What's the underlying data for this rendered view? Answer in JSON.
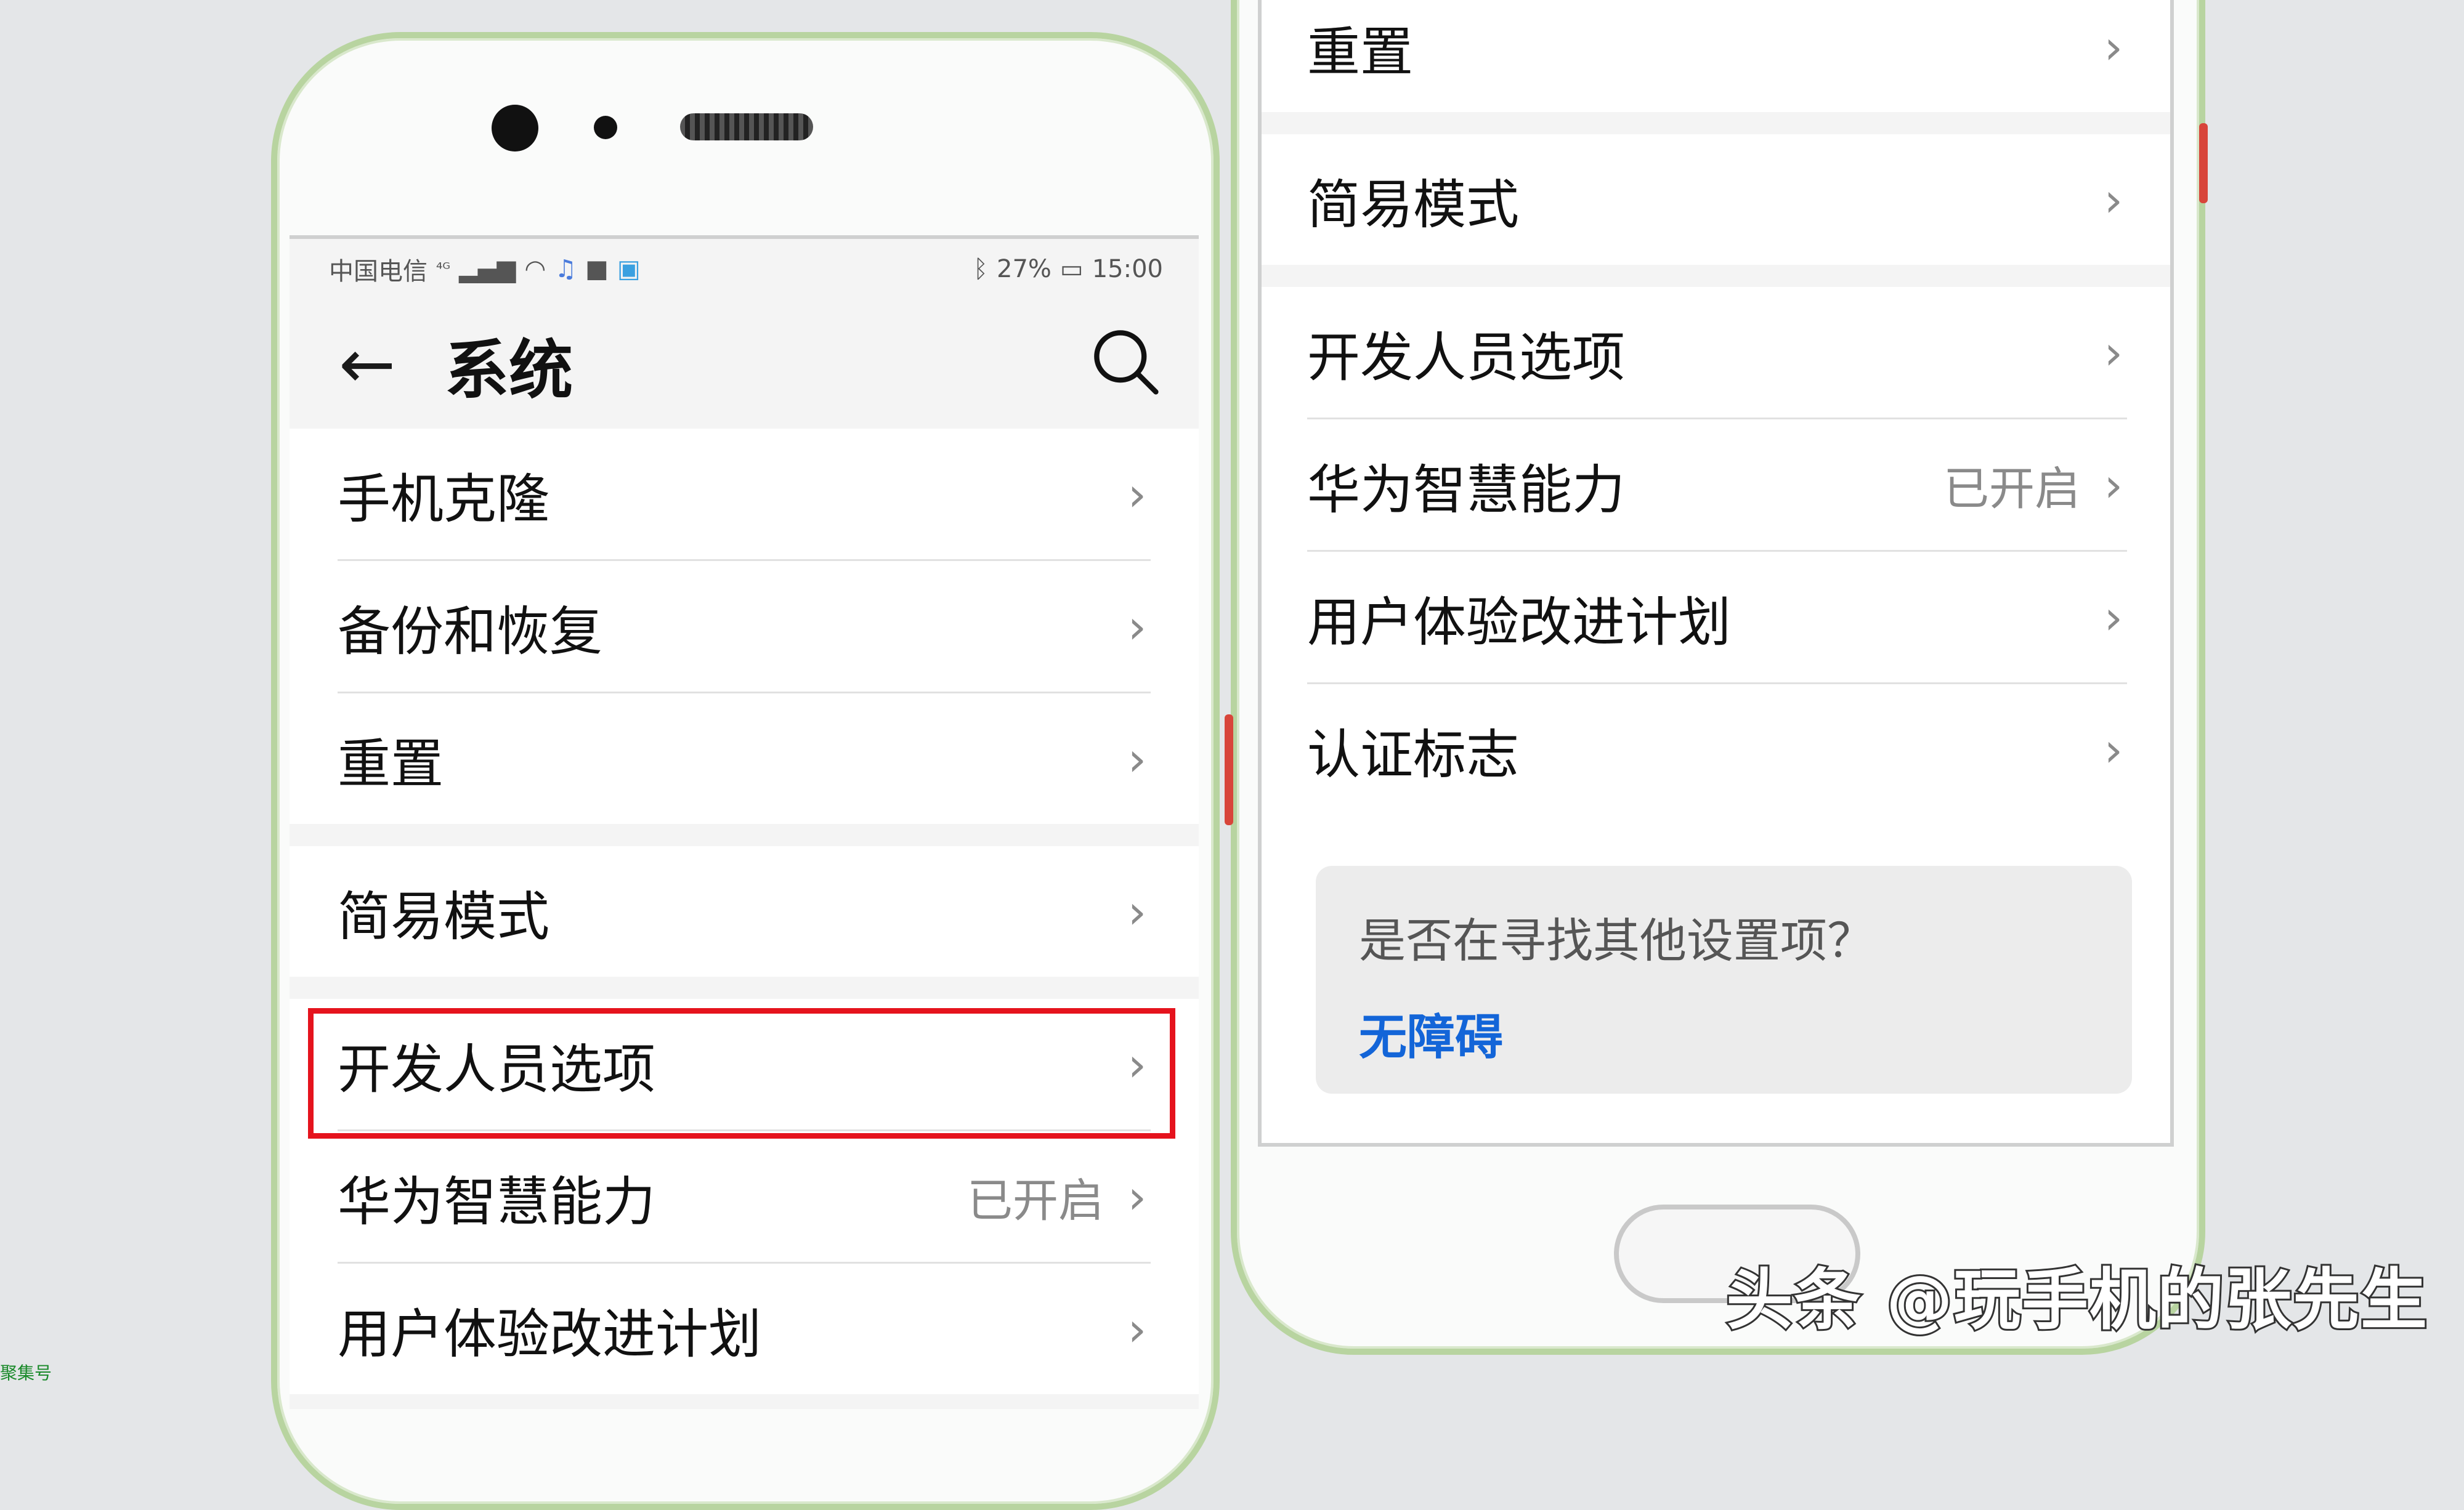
{
  "status_bar": {
    "carrier": "中国电信",
    "network": "⁴ᴳ",
    "battery_percent": "27%",
    "time": "15:00"
  },
  "header": {
    "back_icon": "arrow-left-icon",
    "title": "系统",
    "search_icon": "search-icon"
  },
  "left_screen": {
    "groups": [
      {
        "items": [
          {
            "label": "手机克隆"
          },
          {
            "label": "备份和恢复"
          },
          {
            "label": "重置"
          }
        ]
      },
      {
        "items": [
          {
            "label": "简易模式"
          }
        ]
      },
      {
        "items": [
          {
            "label": "开发人员选项"
          },
          {
            "label": "华为智慧能力",
            "value": "已开启"
          },
          {
            "label": "用户体验改进计划"
          }
        ]
      }
    ],
    "highlighted_item": "开发人员选项"
  },
  "right_screen": {
    "groups": [
      {
        "items": [
          {
            "label": "重置"
          }
        ]
      },
      {
        "items": [
          {
            "label": "简易模式"
          }
        ]
      },
      {
        "items": [
          {
            "label": "开发人员选项"
          },
          {
            "label": "华为智慧能力",
            "value": "已开启"
          },
          {
            "label": "用户体验改进计划"
          },
          {
            "label": "认证标志"
          }
        ]
      }
    ],
    "help": {
      "title": "是否在寻找其他设置项？",
      "link": "无障碍"
    }
  },
  "watermark": "头条 @玩手机的张先生",
  "watermark_small": "聚集号",
  "colors": {
    "highlight": "#e5131d",
    "link": "#1365d8",
    "phone_frame": "#b8d4a0"
  }
}
